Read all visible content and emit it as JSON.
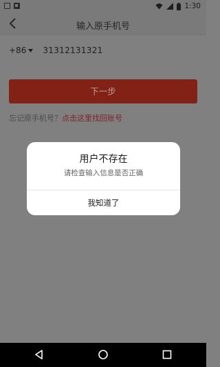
{
  "status_bar": {
    "time": "1:30",
    "icons": [
      "notification-box-icon",
      "sim-icon",
      "wifi-icon",
      "signal-icon",
      "battery-icon"
    ]
  },
  "header": {
    "title": "输入原手机号",
    "back_icon": "chevron-left-icon"
  },
  "form": {
    "country_code": "+86",
    "phone_number": "31312131321",
    "next_button": "下一步",
    "forgot_text": "忘记原手机号？",
    "forgot_link": "点击这里找回账号"
  },
  "dialog": {
    "title": "用户不存在",
    "message": "请检查输入信息是否正确",
    "confirm_button": "我知道了"
  },
  "nav_bar": {
    "icons": [
      "back-triangle-icon",
      "home-circle-icon",
      "recents-square-icon"
    ]
  },
  "colors": {
    "accent": "#822216",
    "link": "#82202a",
    "overlay": "#808080"
  }
}
